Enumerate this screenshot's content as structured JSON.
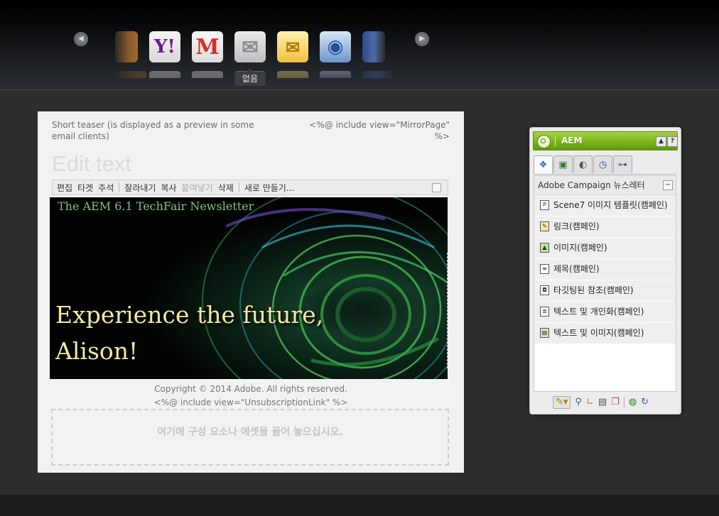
{
  "carousel": {
    "selected_device_label": "없음",
    "devices": [
      "thunderbird-icon",
      "yahoo-mail-icon",
      "gmail-icon",
      "generic-mail-icon",
      "outlook-icon",
      "thunderbird-icon",
      "apple-mail-icon"
    ]
  },
  "email": {
    "teaser": "Short teaser (is displayed as a preview in some email clients)",
    "mirror_include": "<%@ include view=\"MirrorPage\" %>",
    "edit_text_placeholder": "Edit text",
    "toolbar": {
      "edit": "편집",
      "target": "타겟",
      "annotate": "주석",
      "cut": "잘라내기",
      "copy": "복사",
      "paste": "붙여넣기",
      "delete": "삭제",
      "new": "새로 만들기..."
    },
    "banner": {
      "header": "The AEM 6.1 TechFair Newsletter",
      "headline_line1": "Experience the future,",
      "headline_line2": "Alison!"
    },
    "copyright": "Copyright © 2014 Adobe. All rights reserved.",
    "unsubscribe_include": "<%@ include view=\"UnsubscriptionLink\" %>",
    "dropzone": "여기에 구성 요소나 에셋을 끌어 놓으십시오."
  },
  "sidekick": {
    "title": "AEM",
    "group": "Adobe Campaign 뉴스레터",
    "components": [
      "Scene7 이미지 템플릿(캠페인)",
      "링크(캠페인)",
      "이미지(캠페인)",
      "제목(캠페인)",
      "타깃팅된 참조(캠페인)",
      "텍스트 및 개인화(캠페인)",
      "텍스트 및 이미지(캠페인)"
    ]
  },
  "colors": {
    "sidekick_accent": "#7bb31b",
    "banner_text": "#f3e9a0",
    "banner_header_text": "#7fc47a"
  }
}
